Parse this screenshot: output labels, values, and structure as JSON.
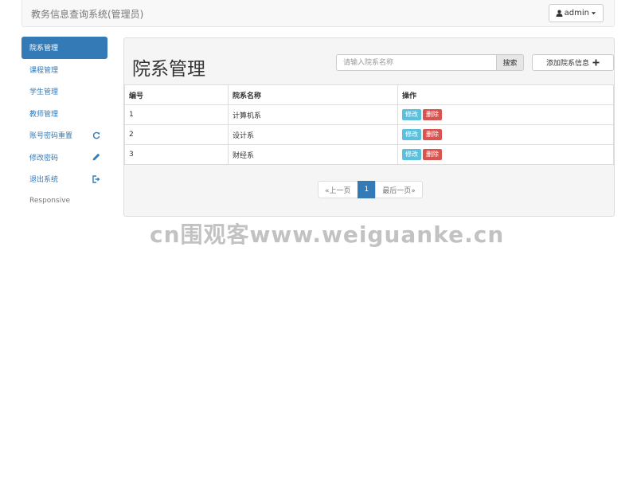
{
  "header": {
    "brand": "教务信息查询系统(管理员)",
    "user_label": "admin",
    "user_icon": "user-icon",
    "caret_icon": "caret-down-icon"
  },
  "sidebar": {
    "items": [
      {
        "label": "院系管理",
        "active": true
      },
      {
        "label": "课程管理"
      },
      {
        "label": "学生管理"
      },
      {
        "label": "教师管理"
      },
      {
        "label": "账号密码重置",
        "icon": "refresh-icon"
      },
      {
        "label": "修改密码",
        "icon": "pencil-icon"
      },
      {
        "label": "退出系统",
        "icon": "logout-icon"
      },
      {
        "label": "Responsive"
      }
    ]
  },
  "main": {
    "title": "院系管理",
    "search": {
      "placeholder": "请输入院系名称",
      "button_label": "搜索"
    },
    "add_button_label": "添加院系信息",
    "add_icon": "plus-icon",
    "table": {
      "headers": [
        "编号",
        "院系名称",
        "操作"
      ],
      "rows": [
        {
          "id": "1",
          "name": "计算机系"
        },
        {
          "id": "2",
          "name": "设计系"
        },
        {
          "id": "3",
          "name": "财经系"
        }
      ],
      "edit_label": "修改",
      "delete_label": "删除"
    },
    "pagination": {
      "prev": "«上一页",
      "current": "1",
      "next": "最后一页»"
    }
  },
  "watermark": "cn围观客www.weiguanke.cn",
  "colors": {
    "primary": "#337ab7",
    "info": "#5bc0de",
    "danger": "#d9534f"
  }
}
